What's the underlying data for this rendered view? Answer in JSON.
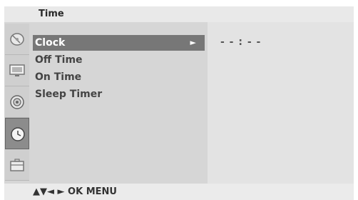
{
  "header": {
    "title": "Time"
  },
  "sidebar": {
    "icons": [
      {
        "name": "satellite-dish-icon",
        "active": false
      },
      {
        "name": "picture-monitor-icon",
        "active": false
      },
      {
        "name": "speaker-icon",
        "active": false
      },
      {
        "name": "clock-icon",
        "active": true
      },
      {
        "name": "toolbox-icon",
        "active": false
      }
    ]
  },
  "menu": {
    "items": [
      {
        "label": "Clock",
        "selected": true,
        "arrow": "►"
      },
      {
        "label": "Off Time",
        "selected": false
      },
      {
        "label": "On Time",
        "selected": false
      },
      {
        "label": "Sleep Timer",
        "selected": false
      }
    ]
  },
  "detail": {
    "clock_value": "- - : - -"
  },
  "footer": {
    "hint": "▲▼◄ ► OK MENU"
  }
}
